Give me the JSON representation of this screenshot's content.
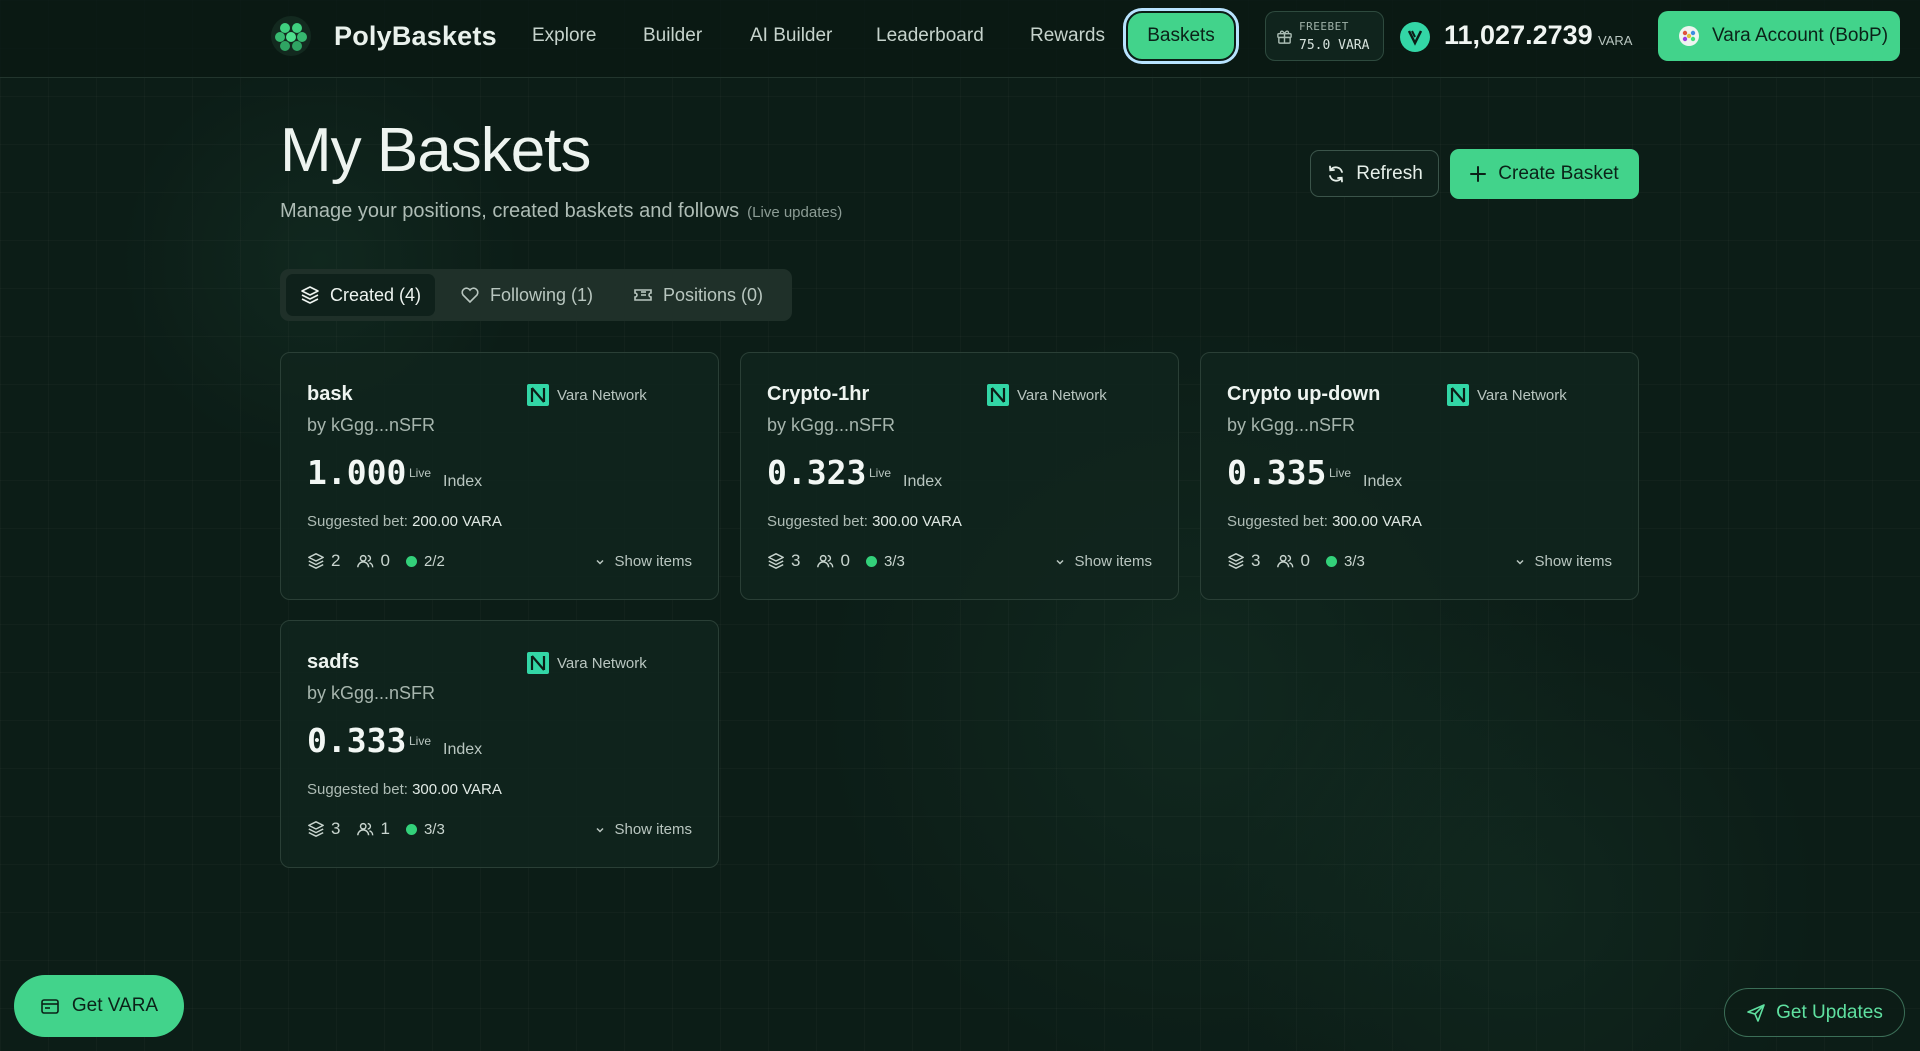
{
  "header": {
    "brand": "PolyBaskets",
    "nav": [
      "Explore",
      "Builder",
      "AI Builder",
      "Leaderboard",
      "Rewards"
    ],
    "active_nav": "Baskets",
    "freebet_label": "FREEBET",
    "freebet_value": "75.0 VARA",
    "balance": "11,027.2739",
    "balance_unit": "VARA",
    "account_label": "Vara Account (BobP)"
  },
  "page": {
    "title": "My Baskets",
    "subtitle": "Manage your positions, created baskets and follows",
    "live_note": "(Live updates)",
    "refresh_label": "Refresh",
    "create_label": "Create Basket"
  },
  "tabs": [
    {
      "label": "Created (4)",
      "icon": "layers-icon",
      "active": true
    },
    {
      "label": "Following (1)",
      "icon": "heart-icon",
      "active": false
    },
    {
      "label": "Positions (0)",
      "icon": "ticket-icon",
      "active": false
    }
  ],
  "cards": [
    {
      "name": "bask",
      "network": "Vara Network",
      "author": "by kGgg...nSFR",
      "index": "1.000",
      "live": "Live",
      "index_label": "Index",
      "bet_label": "Suggested bet:",
      "bet_value": "200.00 VARA",
      "items": "2",
      "followers": "0",
      "status": "2/2",
      "show_items": "Show items"
    },
    {
      "name": "Crypto-1hr",
      "network": "Vara Network",
      "author": "by kGgg...nSFR",
      "index": "0.323",
      "live": "Live",
      "index_label": "Index",
      "bet_label": "Suggested bet:",
      "bet_value": "300.00 VARA",
      "items": "3",
      "followers": "0",
      "status": "3/3",
      "show_items": "Show items"
    },
    {
      "name": "Crypto up-down",
      "network": "Vara Network",
      "author": "by kGgg...nSFR",
      "index": "0.335",
      "live": "Live",
      "index_label": "Index",
      "bet_label": "Suggested bet:",
      "bet_value": "300.00 VARA",
      "items": "3",
      "followers": "0",
      "status": "3/3",
      "show_items": "Show items"
    },
    {
      "name": "sadfs",
      "network": "Vara Network",
      "author": "by kGgg...nSFR",
      "index": "0.333",
      "live": "Live",
      "index_label": "Index",
      "bet_label": "Suggested bet:",
      "bet_value": "300.00 VARA",
      "items": "3",
      "followers": "1",
      "status": "3/3",
      "show_items": "Show items"
    }
  ],
  "footer": {
    "get_vara": "Get VARA",
    "get_updates": "Get Updates"
  },
  "colors": {
    "accent": "#42d38b",
    "background": "#0c1d17",
    "status_green": "#33d17a"
  }
}
